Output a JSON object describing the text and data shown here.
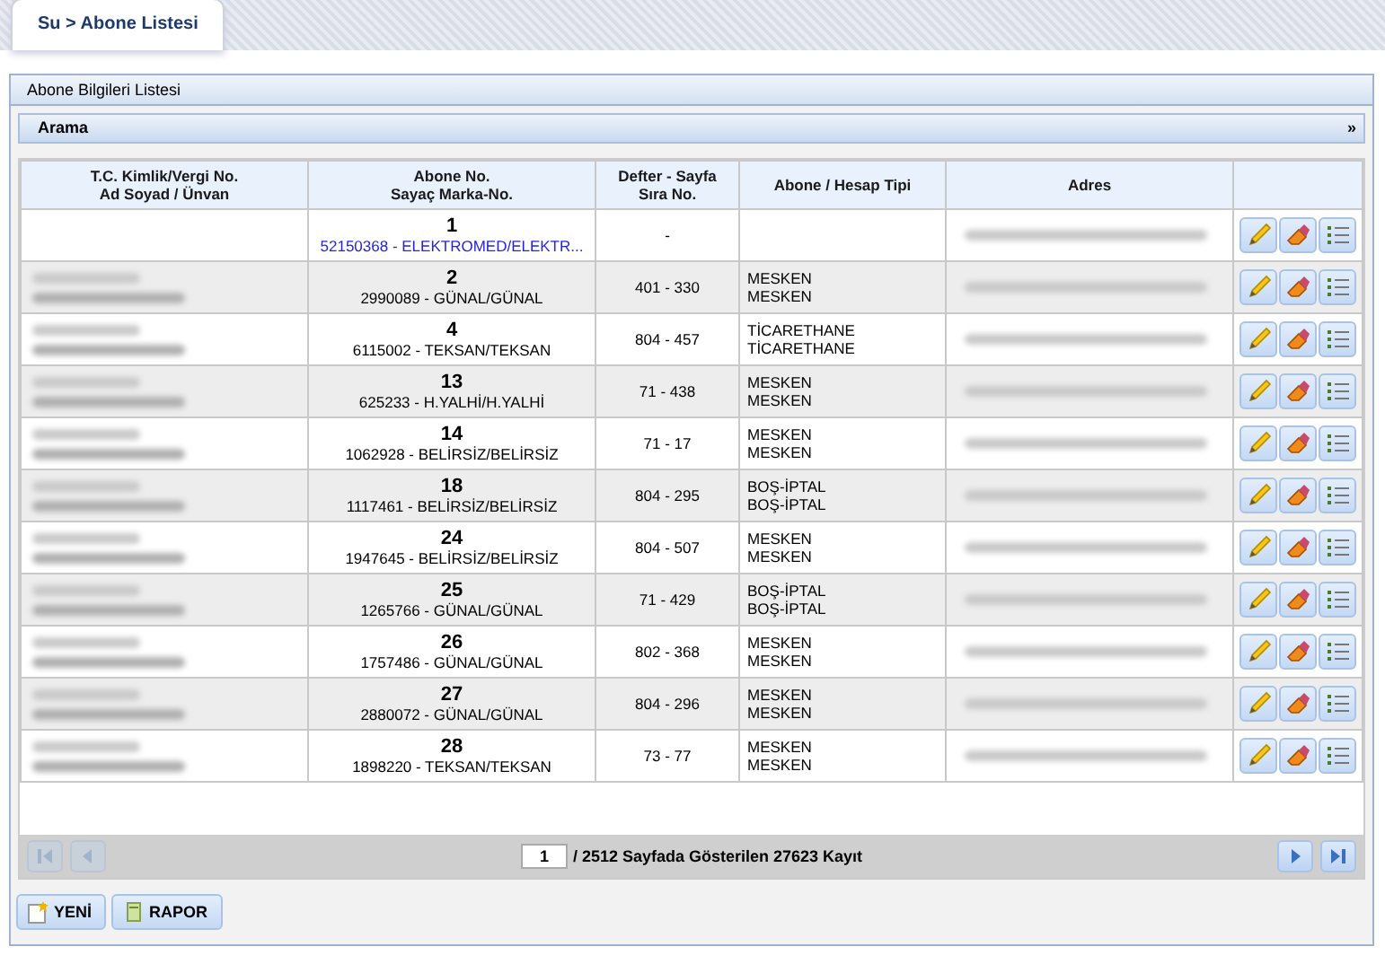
{
  "tab": {
    "title": "Su > Abone Listesi"
  },
  "panel": {
    "title": "Abone Bilgileri Listesi",
    "search_title": "Arama",
    "search_toggle": "»",
    "search_expanded": false
  },
  "table": {
    "columns": [
      [
        "T.C. Kimlik/Vergi No.",
        "Ad Soyad / Ünvan"
      ],
      [
        "Abone No.",
        "Sayaç Marka-No."
      ],
      [
        "Defter - Sayfa",
        "Sıra No."
      ],
      [
        "Abone / Hesap Tipi"
      ],
      [
        "Adres"
      ],
      []
    ],
    "rows": [
      {
        "abone_no": "1",
        "meter": "52150368 - ELEKTROMED/ELEKTR...",
        "meter_link": true,
        "defter": "-",
        "types": [],
        "name_hidden": false
      },
      {
        "abone_no": "2",
        "meter": "2990089 - GÜNAL/GÜNAL",
        "meter_link": false,
        "defter": "401 - 330",
        "types": [
          "MESKEN",
          "MESKEN"
        ],
        "name_hidden": true
      },
      {
        "abone_no": "4",
        "meter": "6115002 - TEKSAN/TEKSAN",
        "meter_link": false,
        "defter": "804 - 457",
        "types": [
          "TİCARETHANE",
          "TİCARETHANE"
        ],
        "name_hidden": true
      },
      {
        "abone_no": "13",
        "meter": "625233 - H.YALHİ/H.YALHİ",
        "meter_link": false,
        "defter": "71 - 438",
        "types": [
          "MESKEN",
          "MESKEN"
        ],
        "name_hidden": true
      },
      {
        "abone_no": "14",
        "meter": "1062928 - BELİRSİZ/BELİRSİZ",
        "meter_link": false,
        "defter": "71 - 17",
        "types": [
          "MESKEN",
          "MESKEN"
        ],
        "name_hidden": true
      },
      {
        "abone_no": "18",
        "meter": "1117461 - BELİRSİZ/BELİRSİZ",
        "meter_link": false,
        "defter": "804 - 295",
        "types": [
          "BOŞ-İPTAL",
          "BOŞ-İPTAL"
        ],
        "name_hidden": true
      },
      {
        "abone_no": "24",
        "meter": "1947645 - BELİRSİZ/BELİRSİZ",
        "meter_link": false,
        "defter": "804 - 507",
        "types": [
          "MESKEN",
          "MESKEN"
        ],
        "name_hidden": true
      },
      {
        "abone_no": "25",
        "meter": "1265766 - GÜNAL/GÜNAL",
        "meter_link": false,
        "defter": "71 - 429",
        "types": [
          "BOŞ-İPTAL",
          "BOŞ-İPTAL"
        ],
        "name_hidden": true
      },
      {
        "abone_no": "26",
        "meter": "1757486 - GÜNAL/GÜNAL",
        "meter_link": false,
        "defter": "802 - 368",
        "types": [
          "MESKEN",
          "MESKEN"
        ],
        "name_hidden": true
      },
      {
        "abone_no": "27",
        "meter": "2880072 - GÜNAL/GÜNAL",
        "meter_link": false,
        "defter": "804 - 296",
        "types": [
          "MESKEN",
          "MESKEN"
        ],
        "name_hidden": true
      },
      {
        "abone_no": "28",
        "meter": "1898220 - TEKSAN/TEKSAN",
        "meter_link": false,
        "defter": "73 - 77",
        "types": [
          "MESKEN",
          "MESKEN"
        ],
        "name_hidden": true
      }
    ]
  },
  "pager": {
    "page": "1",
    "summary": "/ 2512 Sayfada Gösterilen 27623 Kayıt",
    "first_disabled": true,
    "prev_disabled": true,
    "next_disabled": false,
    "last_disabled": false
  },
  "buttons": [
    "YENİ",
    "RAPOR"
  ]
}
